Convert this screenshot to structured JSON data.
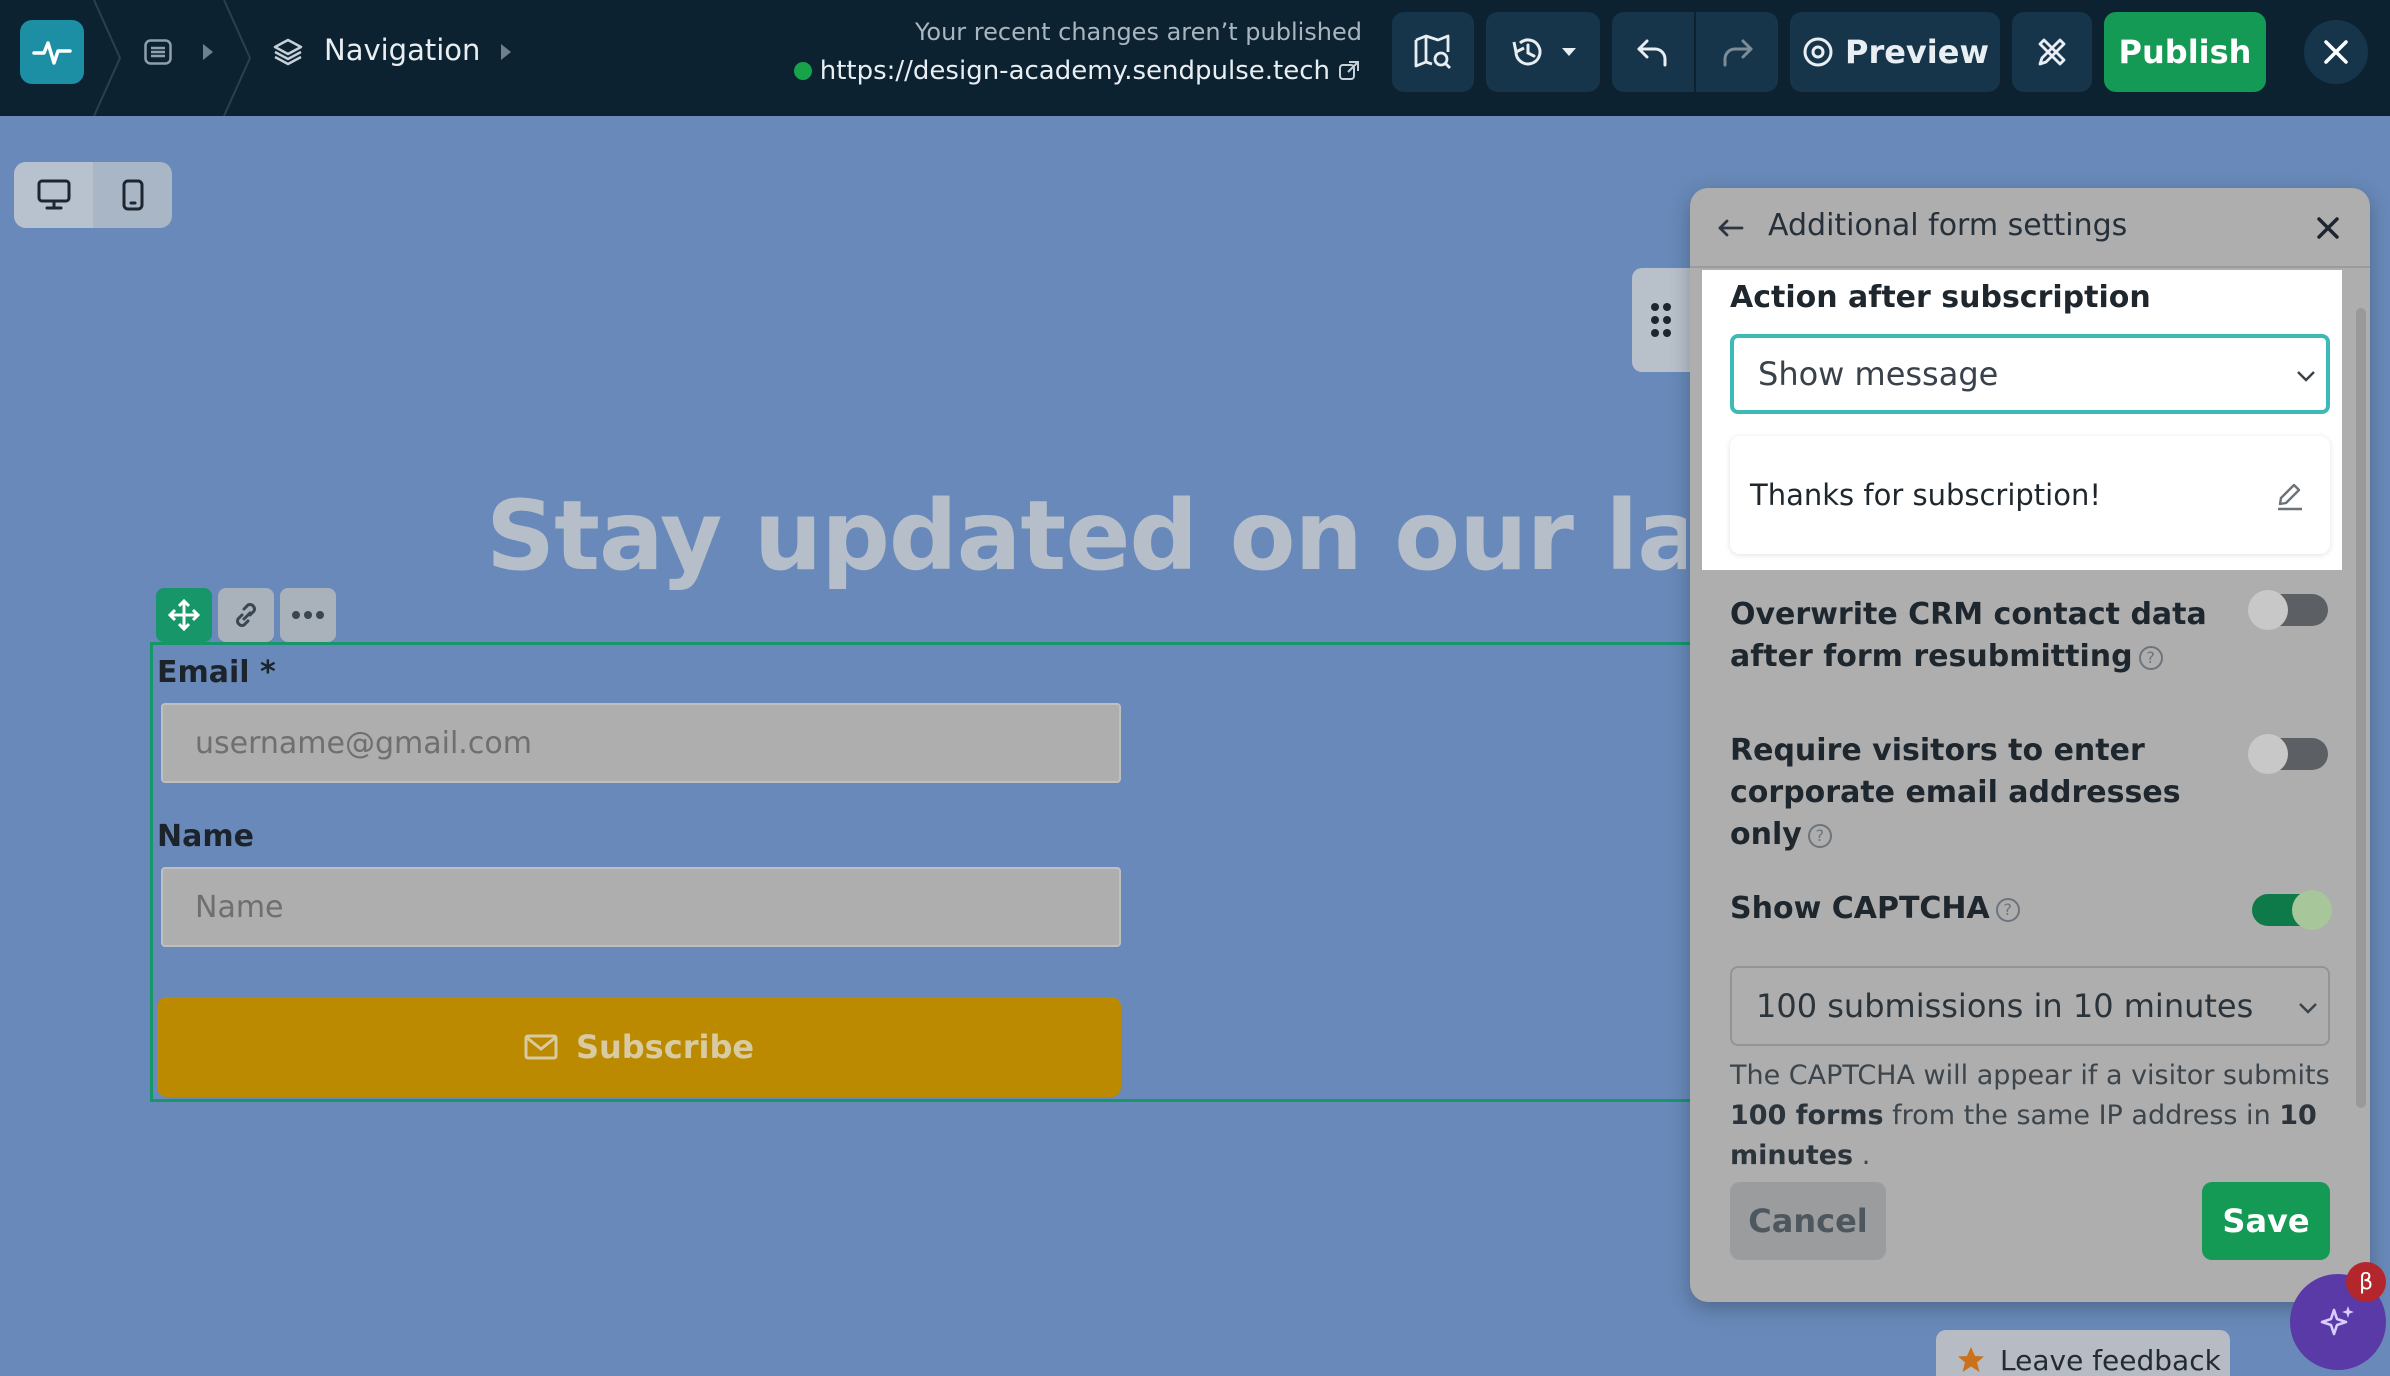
{
  "topbar": {
    "breadcrumb_label": "Navigation",
    "status_text": "Your recent changes aren’t published",
    "site_url": "https://design-academy.sendpulse.tech",
    "preview_label": "Preview",
    "publish_label": "Publish"
  },
  "canvas": {
    "hero_title": "Stay updated on our last n",
    "form": {
      "email_label": "Email *",
      "email_placeholder": "username@gmail.com",
      "name_label": "Name",
      "name_placeholder": "Name",
      "subscribe_label": "Subscribe"
    }
  },
  "panel": {
    "title": "Additional form settings",
    "action_title": "Action after subscription",
    "action_value": "Show message",
    "message_text": "Thanks for subscription!",
    "overwrite_line1": "Overwrite CRM contact data",
    "overwrite_line2": "after form resubmitting",
    "overwrite_on": false,
    "corporate_line1": "Require visitors to enter",
    "corporate_line2": "corporate email addresses",
    "corporate_line3": "only",
    "corporate_on": false,
    "captcha_label": "Show CAPTCHA",
    "captcha_on": true,
    "captcha_value": "100 submissions in 10 minutes",
    "captcha_note_1": "The CAPTCHA will appear if a visitor submits",
    "captcha_note_bold1": "100 forms",
    "captcha_note_2": " from the same IP address in ",
    "captcha_note_bold2": "10",
    "captcha_note_bold3": "minutes",
    "captcha_note_3": " .",
    "cancel_label": "Cancel",
    "save_label": "Save"
  },
  "widgets": {
    "feedback_label": "Leave feedback",
    "beta_badge": "β"
  },
  "colors": {
    "accent_green": "#159a55",
    "topbar_bg": "#0c2230",
    "canvas_bg": "#6889b9",
    "focus_teal": "#3dbab8"
  }
}
